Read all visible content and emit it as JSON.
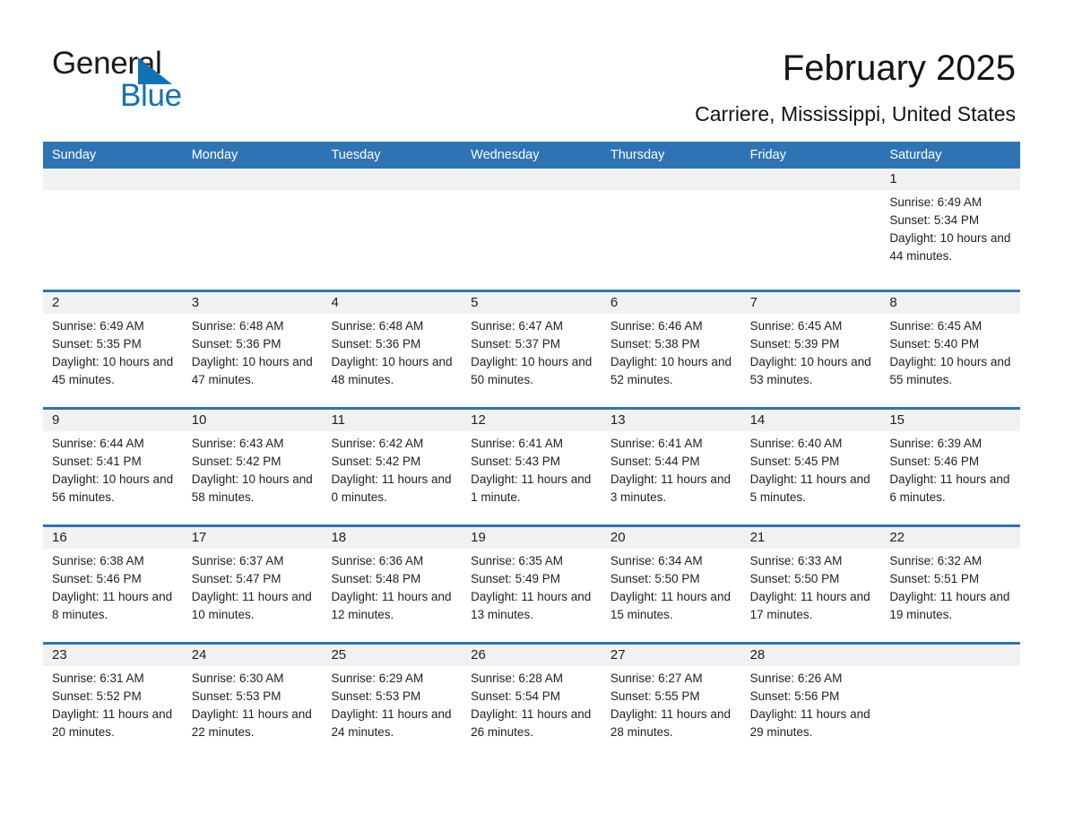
{
  "brand": {
    "name_part1": "General",
    "name_part2": "Blue",
    "triangle_color": "#1272b8"
  },
  "header": {
    "title": "February 2025",
    "subtitle": "Carriere, Mississippi, United States"
  },
  "colors": {
    "header_blue": "#2e74b5",
    "day_number_band": "#f1f1f1",
    "text": "#222222"
  },
  "weekdays": [
    "Sunday",
    "Monday",
    "Tuesday",
    "Wednesday",
    "Thursday",
    "Friday",
    "Saturday"
  ],
  "weeks": [
    {
      "days": [
        {
          "number": "",
          "sunrise": "",
          "sunset": "",
          "daylight": ""
        },
        {
          "number": "",
          "sunrise": "",
          "sunset": "",
          "daylight": ""
        },
        {
          "number": "",
          "sunrise": "",
          "sunset": "",
          "daylight": ""
        },
        {
          "number": "",
          "sunrise": "",
          "sunset": "",
          "daylight": ""
        },
        {
          "number": "",
          "sunrise": "",
          "sunset": "",
          "daylight": ""
        },
        {
          "number": "",
          "sunrise": "",
          "sunset": "",
          "daylight": ""
        },
        {
          "number": "1",
          "sunrise": "Sunrise: 6:49 AM",
          "sunset": "Sunset: 5:34 PM",
          "daylight": "Daylight: 10 hours and 44 minutes."
        }
      ]
    },
    {
      "days": [
        {
          "number": "2",
          "sunrise": "Sunrise: 6:49 AM",
          "sunset": "Sunset: 5:35 PM",
          "daylight": "Daylight: 10 hours and 45 minutes."
        },
        {
          "number": "3",
          "sunrise": "Sunrise: 6:48 AM",
          "sunset": "Sunset: 5:36 PM",
          "daylight": "Daylight: 10 hours and 47 minutes."
        },
        {
          "number": "4",
          "sunrise": "Sunrise: 6:48 AM",
          "sunset": "Sunset: 5:36 PM",
          "daylight": "Daylight: 10 hours and 48 minutes."
        },
        {
          "number": "5",
          "sunrise": "Sunrise: 6:47 AM",
          "sunset": "Sunset: 5:37 PM",
          "daylight": "Daylight: 10 hours and 50 minutes."
        },
        {
          "number": "6",
          "sunrise": "Sunrise: 6:46 AM",
          "sunset": "Sunset: 5:38 PM",
          "daylight": "Daylight: 10 hours and 52 minutes."
        },
        {
          "number": "7",
          "sunrise": "Sunrise: 6:45 AM",
          "sunset": "Sunset: 5:39 PM",
          "daylight": "Daylight: 10 hours and 53 minutes."
        },
        {
          "number": "8",
          "sunrise": "Sunrise: 6:45 AM",
          "sunset": "Sunset: 5:40 PM",
          "daylight": "Daylight: 10 hours and 55 minutes."
        }
      ]
    },
    {
      "days": [
        {
          "number": "9",
          "sunrise": "Sunrise: 6:44 AM",
          "sunset": "Sunset: 5:41 PM",
          "daylight": "Daylight: 10 hours and 56 minutes."
        },
        {
          "number": "10",
          "sunrise": "Sunrise: 6:43 AM",
          "sunset": "Sunset: 5:42 PM",
          "daylight": "Daylight: 10 hours and 58 minutes."
        },
        {
          "number": "11",
          "sunrise": "Sunrise: 6:42 AM",
          "sunset": "Sunset: 5:42 PM",
          "daylight": "Daylight: 11 hours and 0 minutes."
        },
        {
          "number": "12",
          "sunrise": "Sunrise: 6:41 AM",
          "sunset": "Sunset: 5:43 PM",
          "daylight": "Daylight: 11 hours and 1 minute."
        },
        {
          "number": "13",
          "sunrise": "Sunrise: 6:41 AM",
          "sunset": "Sunset: 5:44 PM",
          "daylight": "Daylight: 11 hours and 3 minutes."
        },
        {
          "number": "14",
          "sunrise": "Sunrise: 6:40 AM",
          "sunset": "Sunset: 5:45 PM",
          "daylight": "Daylight: 11 hours and 5 minutes."
        },
        {
          "number": "15",
          "sunrise": "Sunrise: 6:39 AM",
          "sunset": "Sunset: 5:46 PM",
          "daylight": "Daylight: 11 hours and 6 minutes."
        }
      ]
    },
    {
      "days": [
        {
          "number": "16",
          "sunrise": "Sunrise: 6:38 AM",
          "sunset": "Sunset: 5:46 PM",
          "daylight": "Daylight: 11 hours and 8 minutes."
        },
        {
          "number": "17",
          "sunrise": "Sunrise: 6:37 AM",
          "sunset": "Sunset: 5:47 PM",
          "daylight": "Daylight: 11 hours and 10 minutes."
        },
        {
          "number": "18",
          "sunrise": "Sunrise: 6:36 AM",
          "sunset": "Sunset: 5:48 PM",
          "daylight": "Daylight: 11 hours and 12 minutes."
        },
        {
          "number": "19",
          "sunrise": "Sunrise: 6:35 AM",
          "sunset": "Sunset: 5:49 PM",
          "daylight": "Daylight: 11 hours and 13 minutes."
        },
        {
          "number": "20",
          "sunrise": "Sunrise: 6:34 AM",
          "sunset": "Sunset: 5:50 PM",
          "daylight": "Daylight: 11 hours and 15 minutes."
        },
        {
          "number": "21",
          "sunrise": "Sunrise: 6:33 AM",
          "sunset": "Sunset: 5:50 PM",
          "daylight": "Daylight: 11 hours and 17 minutes."
        },
        {
          "number": "22",
          "sunrise": "Sunrise: 6:32 AM",
          "sunset": "Sunset: 5:51 PM",
          "daylight": "Daylight: 11 hours and 19 minutes."
        }
      ]
    },
    {
      "days": [
        {
          "number": "23",
          "sunrise": "Sunrise: 6:31 AM",
          "sunset": "Sunset: 5:52 PM",
          "daylight": "Daylight: 11 hours and 20 minutes."
        },
        {
          "number": "24",
          "sunrise": "Sunrise: 6:30 AM",
          "sunset": "Sunset: 5:53 PM",
          "daylight": "Daylight: 11 hours and 22 minutes."
        },
        {
          "number": "25",
          "sunrise": "Sunrise: 6:29 AM",
          "sunset": "Sunset: 5:53 PM",
          "daylight": "Daylight: 11 hours and 24 minutes."
        },
        {
          "number": "26",
          "sunrise": "Sunrise: 6:28 AM",
          "sunset": "Sunset: 5:54 PM",
          "daylight": "Daylight: 11 hours and 26 minutes."
        },
        {
          "number": "27",
          "sunrise": "Sunrise: 6:27 AM",
          "sunset": "Sunset: 5:55 PM",
          "daylight": "Daylight: 11 hours and 28 minutes."
        },
        {
          "number": "28",
          "sunrise": "Sunrise: 6:26 AM",
          "sunset": "Sunset: 5:56 PM",
          "daylight": "Daylight: 11 hours and 29 minutes."
        },
        {
          "number": "",
          "sunrise": "",
          "sunset": "",
          "daylight": ""
        }
      ]
    }
  ]
}
